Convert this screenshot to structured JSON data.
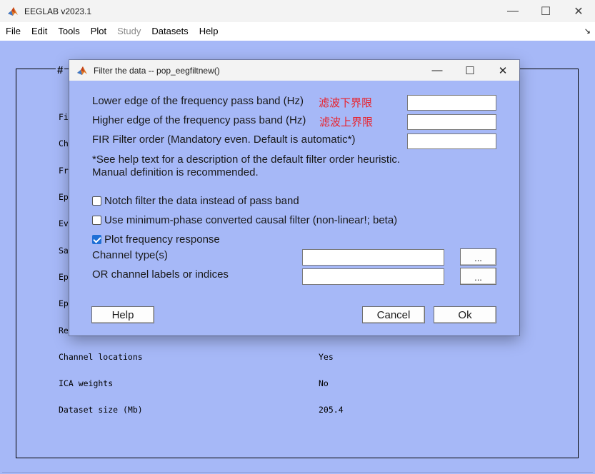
{
  "window": {
    "title": "EEGLAB v2023.1",
    "controls": {
      "minimize": "—",
      "maximize": "☐",
      "close": "✕"
    }
  },
  "menubar": {
    "items": [
      {
        "label": "File",
        "enabled": true
      },
      {
        "label": "Edit",
        "enabled": true
      },
      {
        "label": "Tools",
        "enabled": true
      },
      {
        "label": "Plot",
        "enabled": true
      },
      {
        "label": "Study",
        "enabled": false
      },
      {
        "label": "Datasets",
        "enabled": true
      },
      {
        "label": "Help",
        "enabled": true
      }
    ],
    "overflow_arrow": "↘"
  },
  "main_panel": {
    "title_partial": "#",
    "rows": [
      {
        "label": "Fi",
        "value": ""
      },
      {
        "label": "Ch",
        "value": ""
      },
      {
        "label": "Fr",
        "value": ""
      },
      {
        "label": "Ep",
        "value": ""
      },
      {
        "label": "Ev",
        "value": ""
      },
      {
        "label": "Sa",
        "value": ""
      },
      {
        "label": "Ep",
        "value": ""
      },
      {
        "label": "Ep",
        "value": ""
      },
      {
        "label": "Re",
        "value": ""
      },
      {
        "label": "Channel locations",
        "value": "Yes"
      },
      {
        "label": "ICA weights",
        "value": "No"
      },
      {
        "label": "Dataset size (Mb)",
        "value": "205.4"
      }
    ]
  },
  "dialog": {
    "title": "Filter the data -- pop_eegfiltnew()",
    "controls": {
      "minimize": "—",
      "maximize": "☐",
      "close": "✕"
    },
    "lower_edge": {
      "label": "Lower edge of the frequency pass band (Hz)",
      "annotation": "滤波下界限",
      "value": ""
    },
    "higher_edge": {
      "label": "Higher edge of the frequency pass band (Hz)",
      "annotation": "滤波上界限",
      "value": ""
    },
    "filter_order": {
      "label": "FIR Filter order (Mandatory even. Default is automatic*)",
      "value": ""
    },
    "note_line1": "*See help text for a description of the default filter order heuristic.",
    "note_line2": "Manual definition is recommended.",
    "notch": {
      "label": "Notch filter the data instead of pass band",
      "checked": false
    },
    "min_phase": {
      "label": "Use minimum-phase converted causal filter (non-linear!; beta)",
      "checked": false
    },
    "plot_freq": {
      "label": "Plot frequency response",
      "checked": true
    },
    "channel_type": {
      "label": "Channel type(s)",
      "value": "",
      "browse": "..."
    },
    "channel_labels": {
      "label": "OR channel labels or indices",
      "value": "",
      "browse": "..."
    },
    "buttons": {
      "help": "Help",
      "cancel": "Cancel",
      "ok": "Ok"
    }
  },
  "colors": {
    "background": "#a6b8f7",
    "annotation_red": "#e8232e",
    "checkbox_blue": "#1f6fd6"
  }
}
